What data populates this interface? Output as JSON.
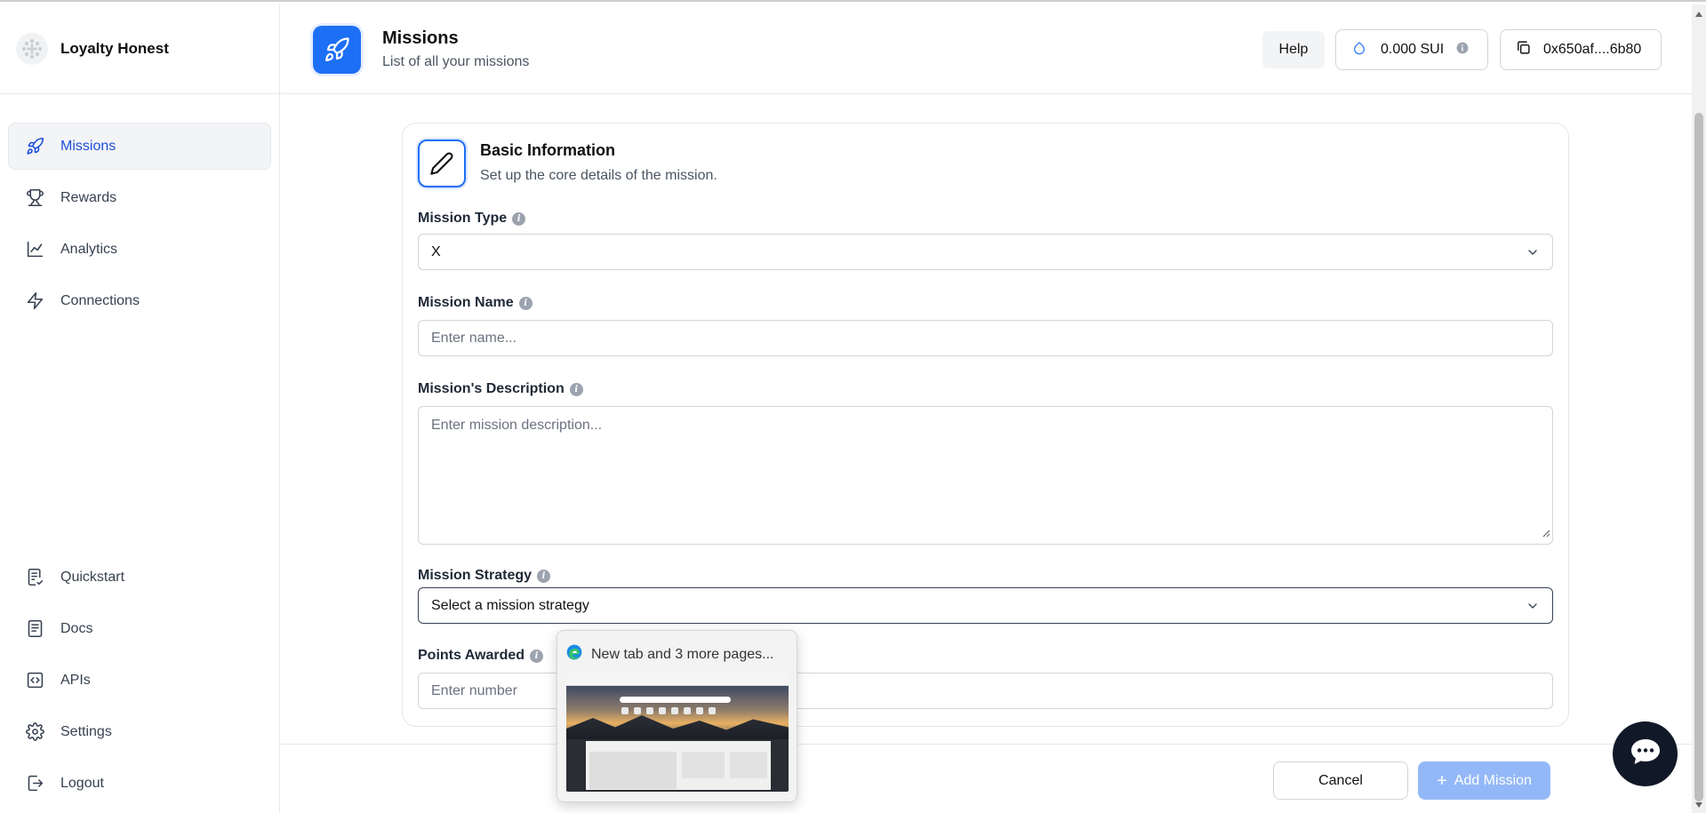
{
  "app": {
    "brand_name": "Loyalty Honest"
  },
  "sidebar": {
    "items": [
      {
        "label": "Missions",
        "icon": "rocket-icon",
        "active": true
      },
      {
        "label": "Rewards",
        "icon": "trophy-icon",
        "active": false
      },
      {
        "label": "Analytics",
        "icon": "chart-line-icon",
        "active": false
      },
      {
        "label": "Connections",
        "icon": "lightning-icon",
        "active": false
      }
    ],
    "bottom_items": [
      {
        "label": "Quickstart",
        "icon": "checklist-icon"
      },
      {
        "label": "Docs",
        "icon": "document-icon"
      },
      {
        "label": "APIs",
        "icon": "code-icon"
      },
      {
        "label": "Settings",
        "icon": "gear-icon"
      },
      {
        "label": "Logout",
        "icon": "logout-icon"
      }
    ]
  },
  "header": {
    "title": "Missions",
    "subtitle": "List of all your missions",
    "help_label": "Help",
    "balance": "0.000 SUI",
    "address": "0x650af....6b80"
  },
  "form": {
    "section_title": "Basic Information",
    "section_subtitle": "Set up the core details of the mission.",
    "mission_type": {
      "label": "Mission Type",
      "value": "X"
    },
    "mission_name": {
      "label": "Mission Name",
      "placeholder": "Enter name..."
    },
    "description": {
      "label": "Mission's Description",
      "placeholder": "Enter mission description..."
    },
    "strategy": {
      "label": "Mission Strategy",
      "value": "Select a mission strategy"
    },
    "points": {
      "label": "Points Awarded",
      "placeholder": "Enter number"
    }
  },
  "footer": {
    "cancel_label": "Cancel",
    "add_label": "Add Mission"
  },
  "taskbar_preview": {
    "title": "New tab and 3 more pages..."
  },
  "colors": {
    "accent": "#1d6ff5",
    "active_nav_text": "#1d4ed8",
    "add_button_disabled": "#93b8f7",
    "chat_button": "#111827"
  }
}
